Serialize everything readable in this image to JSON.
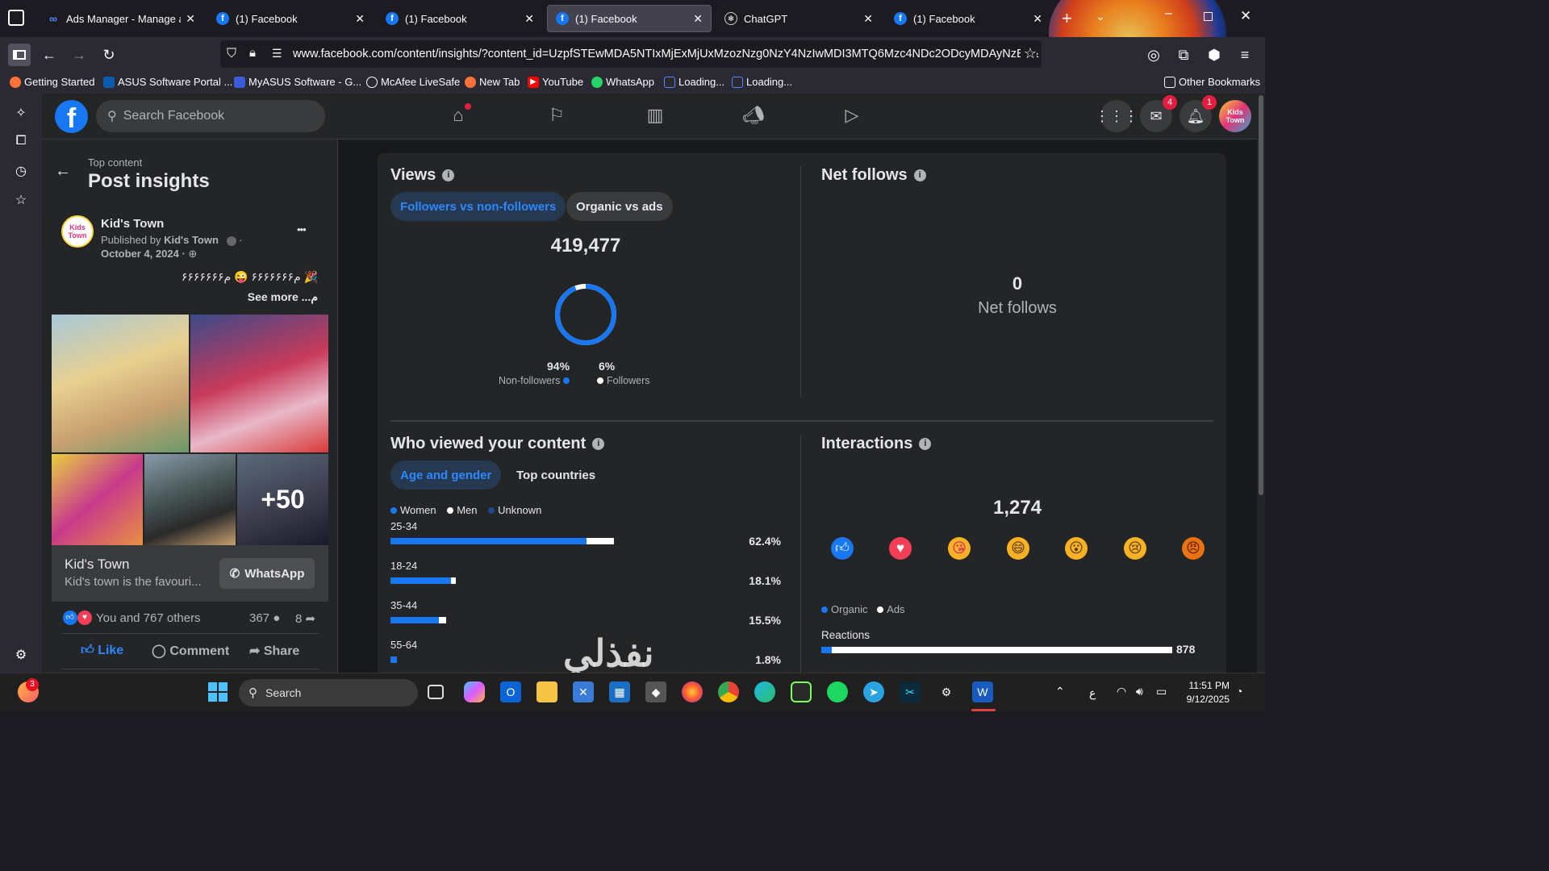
{
  "browser": {
    "tabs": [
      {
        "label": "Ads Manager - Manage ads",
        "icon": "meta-icon",
        "active": false
      },
      {
        "label": "(1) Facebook",
        "icon": "facebook-icon",
        "active": false
      },
      {
        "label": "(1) Facebook",
        "icon": "facebook-icon",
        "active": false
      },
      {
        "label": "(1) Facebook",
        "icon": "facebook-icon",
        "active": true
      },
      {
        "label": "ChatGPT",
        "icon": "chatgpt-icon",
        "active": false
      },
      {
        "label": "(1) Facebook",
        "icon": "facebook-icon",
        "active": false
      }
    ],
    "url": "www.facebook.com/content/insights/?content_id=UzpfSTEwMDA5NTIxMjExMjUxMzozNzg0NzY4NzIwMDI3MTQ6Mzc4NDc2ODcyMDAyNzE0&",
    "bookmarks": [
      "Getting Started",
      "ASUS Software Portal ...",
      "MyASUS Software - G...",
      "McAfee LiveSafe",
      "New Tab",
      "YouTube",
      "WhatsApp",
      "Loading...",
      "Loading..."
    ],
    "other_bookmarks": "Other Bookmarks"
  },
  "facebook": {
    "logo": "f",
    "search_placeholder": "Search Facebook",
    "messenger_badge": "4",
    "notifications_badge": "1"
  },
  "left": {
    "breadcrumb": "Top content",
    "title": "Post insights",
    "page_name": "Kid's Town",
    "published_prefix": "Published by",
    "published_by": "Kid's Town",
    "date": "October 4, 2024 ·",
    "more": "•••",
    "post_text": "🎉 م۶۶۶۶۶۶۶ 😜 م۶۶۶۶۶۶۶",
    "see_more": "See more ...م",
    "more_photos": "+50",
    "link_title": "Kid's Town",
    "link_desc": "Kid's town is the favouri...",
    "whatsapp_btn": "WhatsApp",
    "reactions_text": "You and 767 others",
    "comments_count": "367",
    "shares_count": "8",
    "like": "Like",
    "comment": "Comment",
    "share": "Share",
    "avatar_text": "Kids Town"
  },
  "views": {
    "title": "Views",
    "tabs": [
      "Followers vs non-followers",
      "Organic vs ads"
    ],
    "total": "419,477",
    "non_followers_pct": "94%",
    "non_followers_label": "Non-followers",
    "followers_pct": "6%",
    "followers_label": "Followers",
    "non_followers_fraction": 0.94
  },
  "net_follows": {
    "title": "Net follows",
    "value": "0",
    "label": "Net follows"
  },
  "who_viewed": {
    "title": "Who viewed your content",
    "tabs": [
      "Age and gender",
      "Top countries"
    ],
    "legend": [
      "Women",
      "Men",
      "Unknown"
    ],
    "rows": [
      {
        "age": "25-34",
        "pct": "62.4%",
        "women": 0.553,
        "men": 0.077
      },
      {
        "age": "18-24",
        "pct": "18.1%",
        "women": 0.17,
        "men": 0.013
      },
      {
        "age": "35-44",
        "pct": "15.5%",
        "women": 0.137,
        "men": 0.02
      },
      {
        "age": "55-64",
        "pct": "1.8%",
        "women": 0.018,
        "men": 0.0
      }
    ]
  },
  "interactions": {
    "title": "Interactions",
    "total": "1,274",
    "legend": [
      "Organic",
      "Ads"
    ],
    "reactions_label": "Reactions",
    "reactions_value": "878",
    "reactions_fraction": 0.98,
    "reactions_organic_fraction": 0.03,
    "reaction_icons": [
      "like-icon",
      "love-icon",
      "care-icon",
      "haha-icon",
      "wow-icon",
      "sad-icon",
      "angry-icon"
    ]
  },
  "watermark": "نفذلي",
  "taskbar": {
    "search": "Search",
    "time": "11:51 PM",
    "date": "9/12/2025",
    "lang": "ع",
    "widget_badge": "3"
  }
}
